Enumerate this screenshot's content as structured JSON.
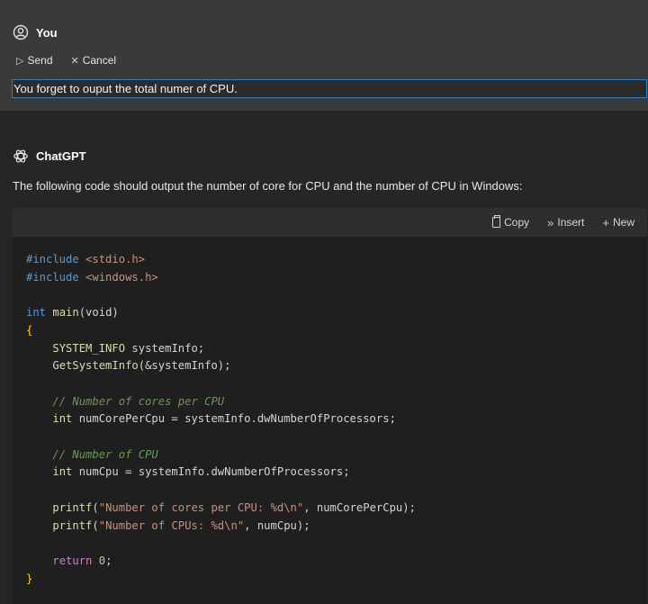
{
  "user": {
    "name": "You",
    "send_label": "Send",
    "cancel_label": "Cancel",
    "edit_value": "You forget to ouput the total numer of CPU."
  },
  "assistant": {
    "name": "ChatGPT",
    "intro": "The following code should output the number of core for CPU and the number of CPU in Windows:"
  },
  "code_toolbar": {
    "copy_label": "Copy",
    "insert_label": "Insert",
    "new_label": "New"
  },
  "code": {
    "line1_directive": "#include",
    "line1_header": "<stdio.h>",
    "line2_directive": "#include",
    "line2_header": "<windows.h>",
    "main_type": "int",
    "main_name": "main",
    "main_params": "(void)",
    "open_brace": "{",
    "l_sysinfo_type": "SYSTEM_INFO",
    "l_sysinfo_rest": " systemInfo;",
    "l_getsys_fn": "GetSystemInfo",
    "l_getsys_rest": "(&systemInfo);",
    "comment1": "// Number of cores per CPU",
    "l_cores_type": "int",
    "l_cores_rest": " numCorePerCpu = systemInfo.dwNumberOfProcessors;",
    "comment2": "// Number of CPU",
    "l_cpu_type": "int",
    "l_cpu_rest": " numCpu = systemInfo.dwNumberOfProcessors;",
    "printf1_fn": "printf",
    "printf1_open": "(",
    "printf1_str": "\"Number of cores per CPU: %d\\n\"",
    "printf1_rest": ", numCorePerCpu);",
    "printf2_fn": "printf",
    "printf2_open": "(",
    "printf2_str": "\"Number of CPUs: %d\\n\"",
    "printf2_rest": ", numCpu);",
    "return_kw": "return",
    "return_val": "0",
    "return_end": ";",
    "close_brace": "}"
  },
  "colors": {
    "accent_input_border": "#2f7fc0",
    "user_block_bg": "#3a3a3a",
    "page_bg": "#262626",
    "code_bg": "#1f1f1f"
  },
  "icons": {
    "user_avatar": "user-circle-icon",
    "assistant_avatar": "openai-logo-icon",
    "send": "send-arrow-icon",
    "cancel": "close-icon",
    "copy": "clipboard-icon",
    "insert": "double-chevron-right-icon",
    "new": "plus-icon"
  }
}
